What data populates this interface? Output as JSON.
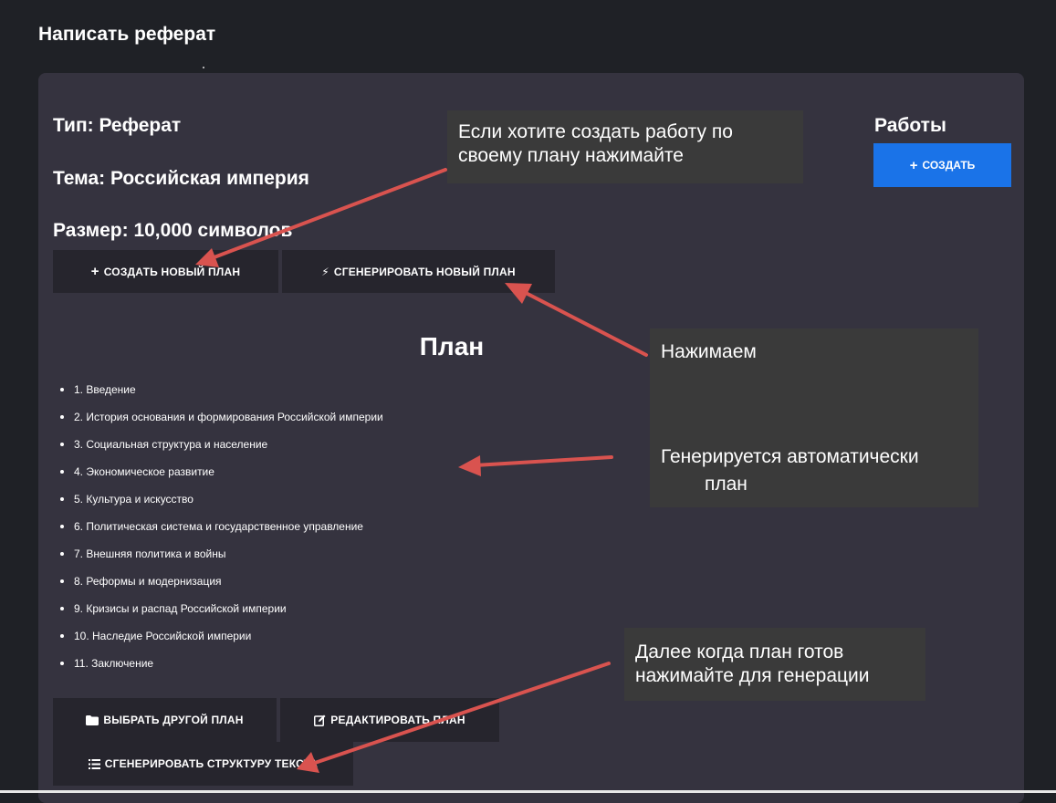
{
  "page": {
    "title": "Написать реферат"
  },
  "meta": {
    "type_line": "Тип: Реферат",
    "topic_line": "Тема: Российская империя",
    "size_line": "Размер: 10,000 символов"
  },
  "plan_buttons": {
    "create_label": "СОЗДАТЬ НОВЫЙ ПЛАН",
    "create_icon": "+",
    "generate_label": "СГЕНЕРИРОВАТЬ НОВЫЙ ПЛАН",
    "generate_icon": "⚡"
  },
  "works": {
    "title": "Работы",
    "create_label": "СОЗДАТЬ",
    "create_icon": "+",
    "accent_color": "#1a73e8"
  },
  "plan": {
    "heading": "План",
    "items": [
      "1. Введение",
      "2. История основания и формирования Российской империи",
      "3. Социальная структура и население",
      "4. Экономическое развитие",
      "5. Культура и искусство",
      "6. Политическая система и государственное управление",
      "7. Внешняя политика и войны",
      "8. Реформы и модернизация",
      "9. Кризисы и распад Российской империи",
      "10. Наследие Российской империи",
      "11. Заключение"
    ]
  },
  "bottom_buttons": {
    "choose_label": "ВЫБРАТЬ ДРУГОЙ ПЛАН",
    "edit_label": "РЕДАКТИРОВАТЬ ПЛАН",
    "structure_label": "СГЕНЕРИРОВАТЬ СТРУКТУРУ ТЕКСТА"
  },
  "callouts": {
    "own_plan": "Если хотите создать работу по своему плану нажимайте",
    "press": "Нажимаем",
    "auto_line1": "Генерируется автоматически",
    "auto_line2": "план",
    "next": "Далее когда план готов нажимайте для генерации"
  },
  "colors": {
    "arrow": "#d9534f",
    "background": "#1f2126",
    "card": "#35333f"
  }
}
